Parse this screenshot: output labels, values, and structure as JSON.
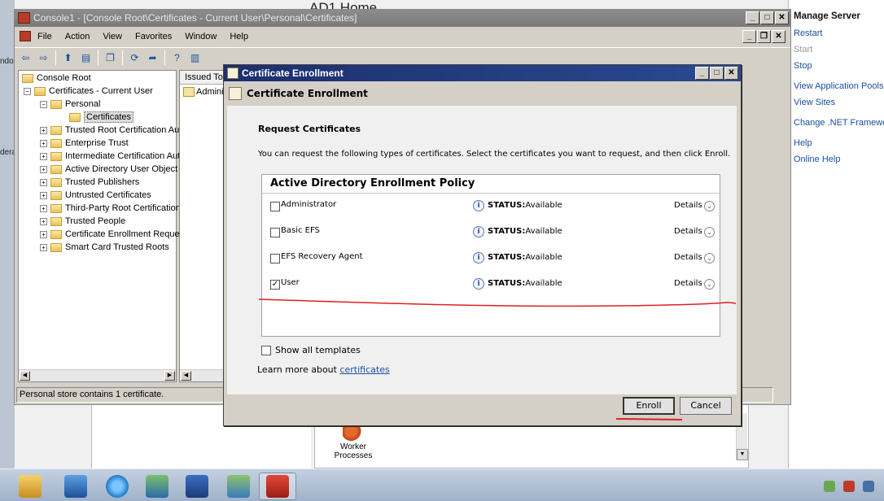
{
  "iis": {
    "title": "AD1 Home",
    "desktop_label_1": "ndo",
    "desktop_label_2": "dera",
    "worker_label": "Worker Processes",
    "actions_header": "Manage Server",
    "actions": [
      {
        "label": "Restart",
        "enabled": true
      },
      {
        "label": "Start",
        "enabled": false
      },
      {
        "label": "Stop",
        "enabled": true
      },
      {
        "label": "View Application Pools",
        "enabled": true
      },
      {
        "label": "View Sites",
        "enabled": true
      },
      {
        "label": "Change .NET Framework",
        "enabled": true
      },
      {
        "label": "Help",
        "enabled": true
      },
      {
        "label": "Online Help",
        "enabled": true
      }
    ]
  },
  "console": {
    "title": "Console1 - [Console Root\\Certificates - Current User\\Personal\\Certificates]",
    "menu": [
      "File",
      "Action",
      "View",
      "Favorites",
      "Window",
      "Help"
    ],
    "tree": [
      {
        "label": "Console Root",
        "level": 0,
        "expander": ""
      },
      {
        "label": "Certificates - Current User",
        "level": 1,
        "expander": "-"
      },
      {
        "label": "Personal",
        "level": 2,
        "expander": "-"
      },
      {
        "label": "Certificates",
        "level": 3,
        "expander": "",
        "selected": true
      },
      {
        "label": "Trusted Root Certification Authorities",
        "level": 2,
        "expander": "+"
      },
      {
        "label": "Enterprise Trust",
        "level": 2,
        "expander": "+"
      },
      {
        "label": "Intermediate Certification Authorities",
        "level": 2,
        "expander": "+"
      },
      {
        "label": "Active Directory User Object",
        "level": 2,
        "expander": "+"
      },
      {
        "label": "Trusted Publishers",
        "level": 2,
        "expander": "+"
      },
      {
        "label": "Untrusted Certificates",
        "level": 2,
        "expander": "+"
      },
      {
        "label": "Third-Party Root Certification Authorities",
        "level": 2,
        "expander": "+"
      },
      {
        "label": "Trusted People",
        "level": 2,
        "expander": "+"
      },
      {
        "label": "Certificate Enrollment Requests",
        "level": 2,
        "expander": "+"
      },
      {
        "label": "Smart Card Trusted Roots",
        "level": 2,
        "expander": "+"
      }
    ],
    "list_header": "Issued To",
    "list_row": "Admini",
    "status": "Personal store contains 1 certificate."
  },
  "dialog": {
    "title": "Certificate Enrollment",
    "header": "Certificate Enrollment",
    "section_title": "Request Certificates",
    "description": "You can request the following types of certificates. Select the certificates you want to request, and then click Enroll.",
    "policy_header": "Active Directory Enrollment Policy",
    "status_label": "STATUS:",
    "details_label": "Details",
    "templates": [
      {
        "name": "Administrator",
        "status": "Available",
        "checked": false
      },
      {
        "name": "Basic EFS",
        "status": "Available",
        "checked": false
      },
      {
        "name": "EFS Recovery Agent",
        "status": "Available",
        "checked": false
      },
      {
        "name": "User",
        "status": "Available",
        "checked": true
      }
    ],
    "show_all_label": "Show all templates",
    "learn_prefix": "Learn more about",
    "learn_link": "certificates",
    "enroll_label": "Enroll",
    "cancel_label": "Cancel"
  },
  "annotation_color": "#e02020",
  "taskbar": [
    "server-manager-icon",
    "powershell-remote-icon",
    "internet-explorer-icon",
    "network-icon",
    "powershell-icon",
    "iis-manager-icon",
    "mmc-toolbox-icon"
  ]
}
